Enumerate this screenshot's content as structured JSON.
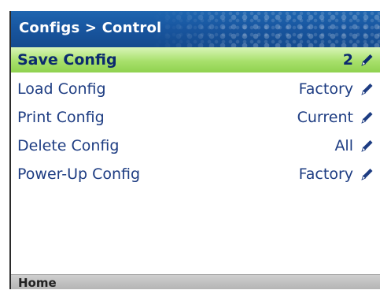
{
  "header": {
    "title": "Configs > Control"
  },
  "menu": {
    "items": [
      {
        "label": "Save Config",
        "value": "2",
        "edit_icon": "pencil-icon"
      },
      {
        "label": "Load Config",
        "value": "Factory",
        "edit_icon": "pencil-icon"
      },
      {
        "label": "Print Config",
        "value": "Current",
        "edit_icon": "pencil-icon"
      },
      {
        "label": "Delete Config",
        "value": "All",
        "edit_icon": "pencil-icon"
      },
      {
        "label": "Power-Up Config",
        "value": "Factory",
        "edit_icon": "pencil-icon"
      }
    ],
    "selected_index": 0
  },
  "footer": {
    "home_label": "Home"
  },
  "colors": {
    "header_blue": "#1856a0",
    "selected_green": "#a8e06c",
    "text_blue": "#1d3c82",
    "footer_gray": "#c2c2c2"
  }
}
